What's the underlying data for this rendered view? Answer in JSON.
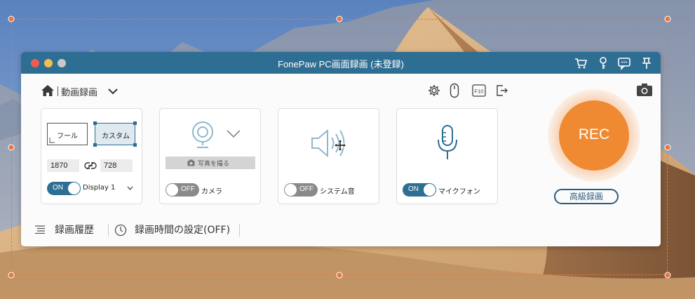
{
  "window": {
    "title": "FonePaw PC画面録画 (未登録)"
  },
  "toolbar": {
    "mode_label": "動画録画"
  },
  "region_card": {
    "full_label": "フール",
    "custom_label": "カスタム",
    "width": "1870",
    "height": "728",
    "toggle_label": "ON",
    "display_label": "Display 1"
  },
  "webcam_card": {
    "photo_label": "写真を撮る",
    "toggle_label": "OFF",
    "label": "カメラ"
  },
  "system_audio_card": {
    "toggle_label": "OFF",
    "label": "システム音"
  },
  "mic_card": {
    "toggle_label": "ON",
    "label": "マイクフォン"
  },
  "bottom": {
    "history_label": "録画履歴",
    "timer_label": "録画時間の設定(OFF)"
  },
  "record": {
    "rec_label": "REC",
    "advanced_label": "高級録画"
  },
  "colors": {
    "titlebar": "#2f6e93",
    "rec": "#f08a32",
    "selection": "#e5773f"
  }
}
